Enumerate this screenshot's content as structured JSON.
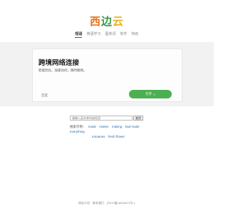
{
  "logo": {
    "char1": "西",
    "char2": "边",
    "char3": "云"
  },
  "nav": {
    "items": [
      "短语",
      "英语学习",
      "图单词",
      "软件",
      "特色"
    ],
    "active_index": 0
  },
  "ad": {
    "title": "跨境网络连接",
    "subtitle": "智能优化，加速访问，随时随地。",
    "left_label": "百度",
    "button_label": "打开",
    "button_arrow": ">"
  },
  "search": {
    "placeholder": "请输入英文单词或短语",
    "button_label": "查找"
  },
  "hot": {
    "label": "搜索示例：",
    "words_row1": [
      "made",
      "makes",
      "making",
      "had made",
      "everything"
    ],
    "words_row2": [
      "tomatoes",
      "fresh flower"
    ]
  },
  "footer": {
    "links": [
      "网站介绍",
      "联系我们",
      "沪ICP备18005574号-1"
    ]
  },
  "colors": {
    "green": "#4caf50",
    "link": "#2a6fb0",
    "logo_orange": "#e8731e",
    "logo_green": "#3a9a4a",
    "logo_yellow": "#e8b21e"
  }
}
